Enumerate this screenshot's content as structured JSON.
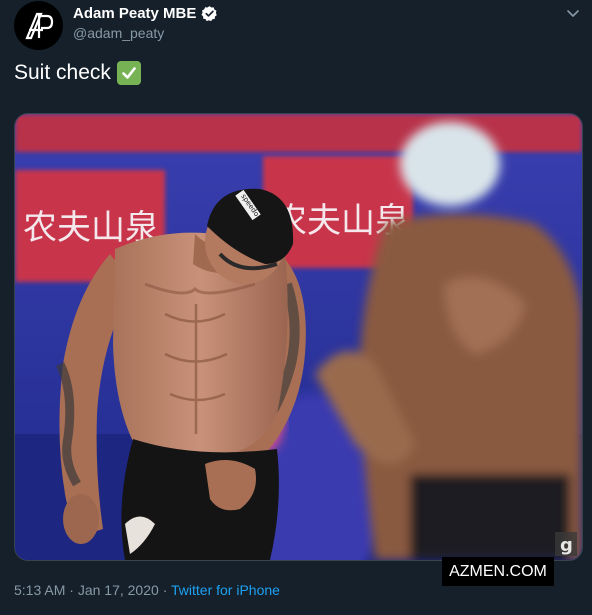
{
  "tweet": {
    "display_name": "Adam Peaty MBE",
    "handle": "@adam_peaty",
    "text": "Suit check",
    "emoji": "white-check-mark",
    "time": "5:13 AM",
    "date": "Jan 17, 2020",
    "separator": "·",
    "source": "Twitter for iPhone"
  },
  "media": {
    "banner_text_left": "农夫山泉",
    "banner_text_right": "农夫山泉",
    "cap_label": "speedo",
    "corner_mark": "g"
  },
  "watermark": "AZMEN.COM",
  "icons": [
    "logo-ap-icon",
    "verified-badge-icon",
    "chevron-down-icon"
  ],
  "colors": {
    "background": "#15202b",
    "secondary_text": "#8899a6",
    "link": "#1da1f2",
    "verified": "#ffffff"
  }
}
